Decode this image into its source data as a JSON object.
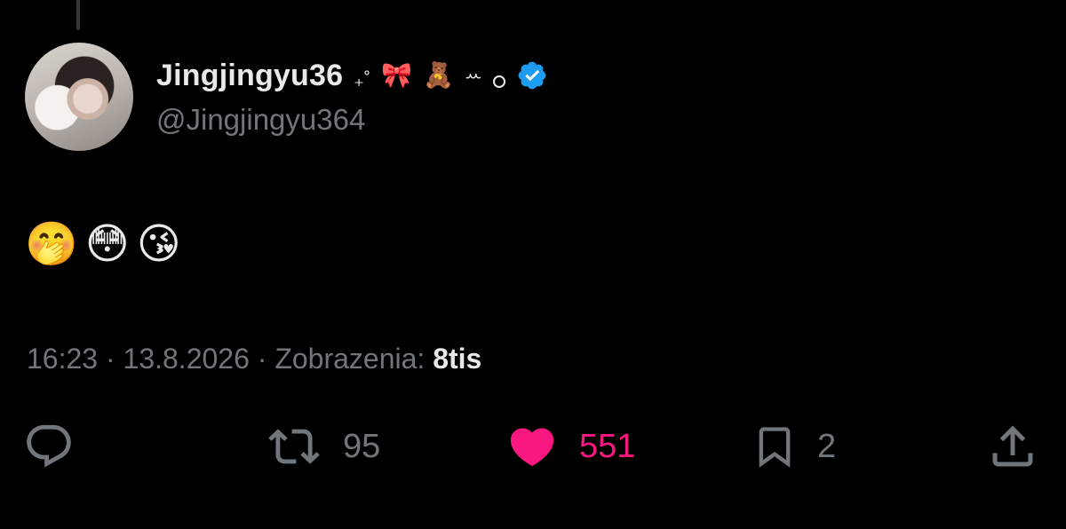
{
  "author": {
    "display_name": "Jingjingyu36",
    "handle": "@Jingjingyu364",
    "name_decorations": [
      "₊˚",
      "🎀",
      "🧸",
      "ꕀ",
      "°"
    ],
    "verified": true,
    "avatar": "profile-photo"
  },
  "tweet": {
    "text": "🤭😳😘"
  },
  "meta": {
    "time": "16:23",
    "separator": "·",
    "date": "13.8.2026",
    "views_label": "Zobrazenia:",
    "views_value": "8tis"
  },
  "actions": {
    "reply": {
      "icon": "reply-icon"
    },
    "retweet": {
      "icon": "retweet-icon",
      "count": "95"
    },
    "like": {
      "icon": "heart-icon",
      "count": "551",
      "active": true,
      "color": "#f91880"
    },
    "bookmark": {
      "icon": "bookmark-icon",
      "count": "2"
    },
    "share": {
      "icon": "share-icon"
    }
  },
  "colors": {
    "background": "#000000",
    "text_primary": "#e7e9ea",
    "text_secondary": "#71767b",
    "verified_blue": "#1d9bf0",
    "like_pink": "#f91880"
  }
}
